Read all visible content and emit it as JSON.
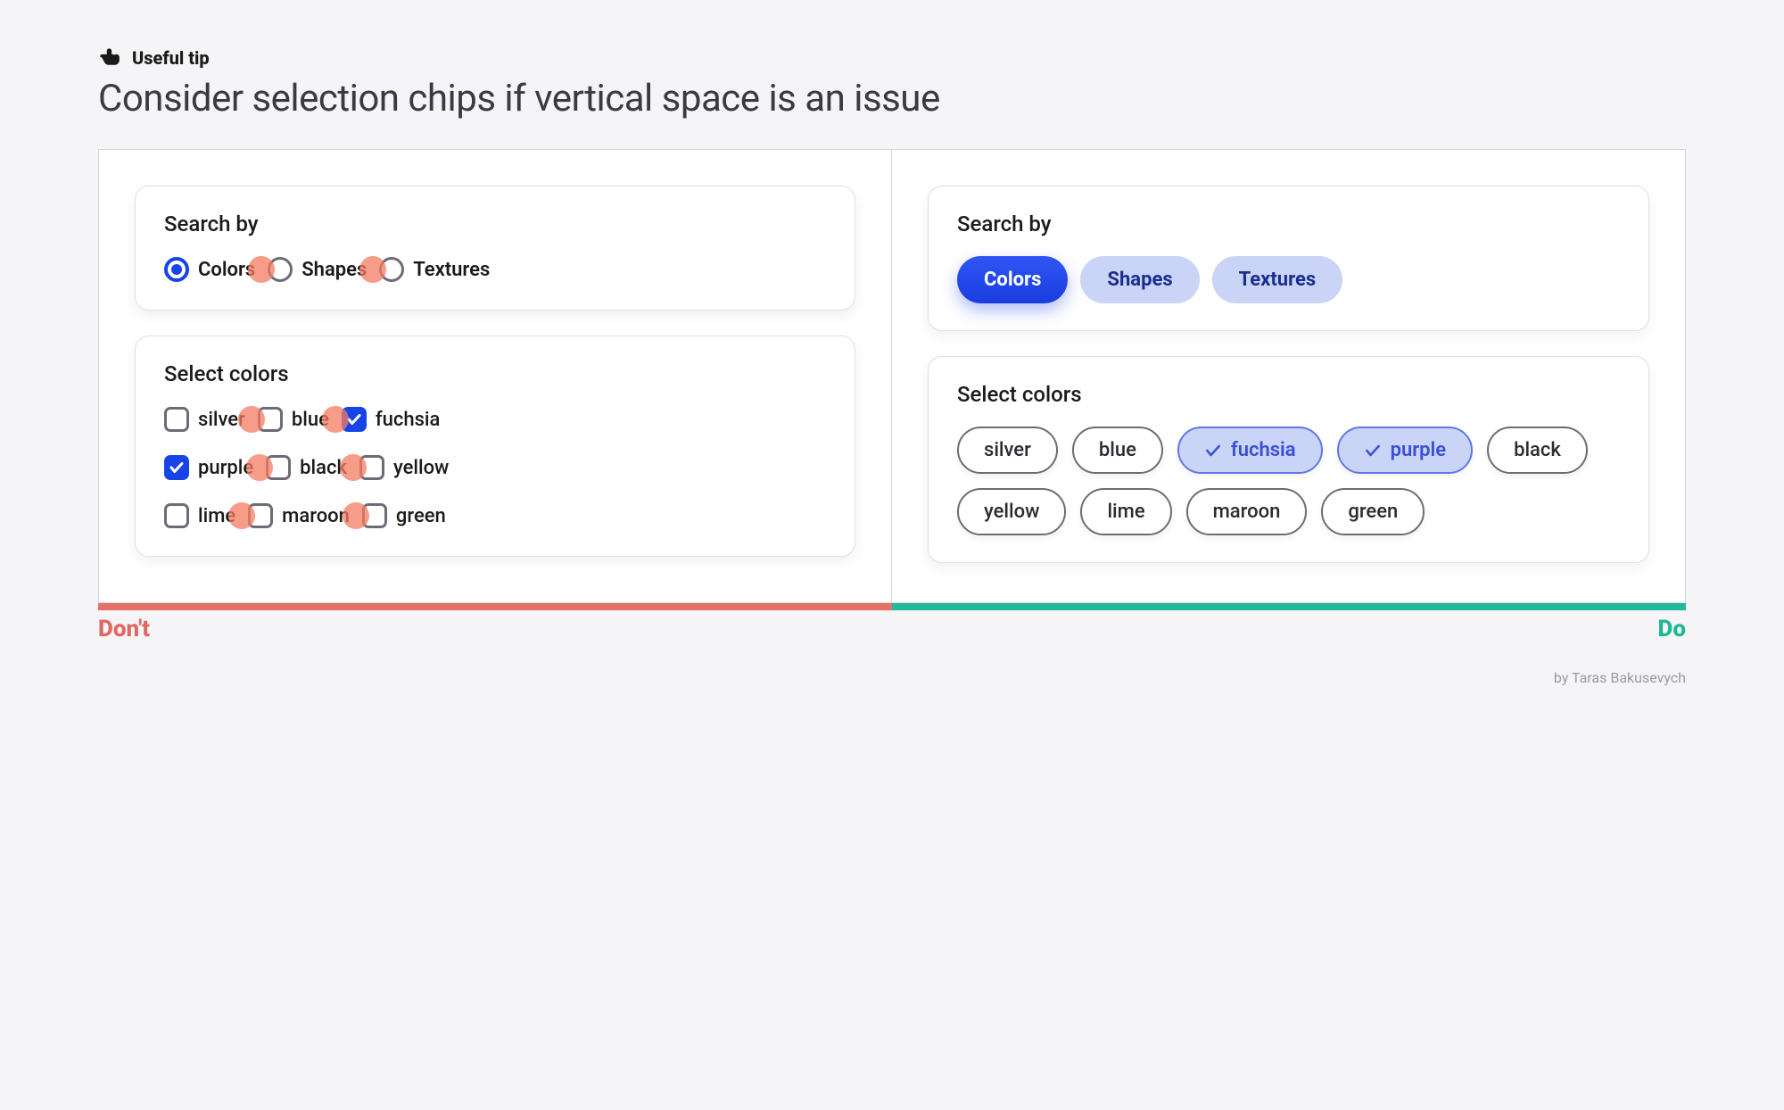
{
  "tip": {
    "label": "Useful tip",
    "headline": "Consider selection chips if vertical space is an issue"
  },
  "dont": {
    "search": {
      "title": "Search by",
      "options": [
        {
          "label": "Colors",
          "selected": true
        },
        {
          "label": "Shapes",
          "selected": false
        },
        {
          "label": "Textures",
          "selected": false
        }
      ]
    },
    "colors": {
      "title": "Select colors",
      "options": [
        {
          "label": "silver",
          "selected": false
        },
        {
          "label": "blue",
          "selected": false
        },
        {
          "label": "fuchsia",
          "selected": true
        },
        {
          "label": "purple",
          "selected": true
        },
        {
          "label": "black",
          "selected": false
        },
        {
          "label": "yellow",
          "selected": false
        },
        {
          "label": "lime",
          "selected": false
        },
        {
          "label": "maroon",
          "selected": false
        },
        {
          "label": "green",
          "selected": false
        }
      ]
    },
    "verdict": "Don't"
  },
  "do": {
    "search": {
      "title": "Search by",
      "options": [
        {
          "label": "Colors",
          "selected": true
        },
        {
          "label": "Shapes",
          "selected": false
        },
        {
          "label": "Textures",
          "selected": false
        }
      ]
    },
    "colors": {
      "title": "Select colors",
      "options": [
        {
          "label": "silver",
          "selected": false
        },
        {
          "label": "blue",
          "selected": false
        },
        {
          "label": "fuchsia",
          "selected": true
        },
        {
          "label": "purple",
          "selected": true
        },
        {
          "label": "black",
          "selected": false
        },
        {
          "label": "yellow",
          "selected": false
        },
        {
          "label": "lime",
          "selected": false
        },
        {
          "label": "maroon",
          "selected": false
        },
        {
          "label": "green",
          "selected": false
        }
      ]
    },
    "verdict": "Do"
  },
  "byline": "by Taras Bakusevych",
  "colors_palette": {
    "accent_blue": "#1744e6",
    "pill_bg": "#c9d4f7",
    "dont_red": "#e76f6a",
    "do_green": "#22b99a",
    "touch_dot": "#f47b61"
  }
}
